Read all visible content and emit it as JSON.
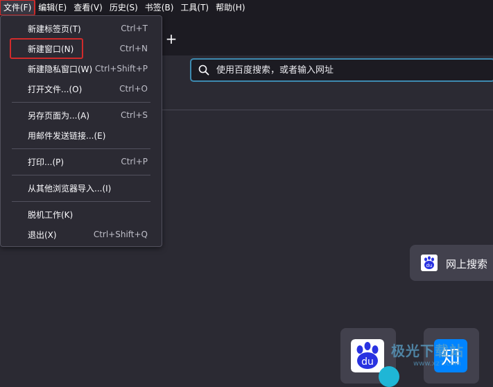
{
  "menubar": {
    "items": [
      "文件(F)",
      "编辑(E)",
      "查看(V)",
      "历史(S)",
      "书签(B)",
      "工具(T)",
      "帮助(H)"
    ]
  },
  "tabstrip": {
    "new_tab_label": "+"
  },
  "urlbar": {
    "placeholder": "使用百度搜索，或者输入网址"
  },
  "file_menu": {
    "items": [
      {
        "label": "新建标签页(T)",
        "shortcut": "Ctrl+T"
      },
      {
        "label": "新建窗口(N)",
        "shortcut": "Ctrl+N"
      },
      {
        "label": "新建隐私窗口(W)",
        "shortcut": "Ctrl+Shift+P"
      },
      {
        "label": "打开文件...(O)",
        "shortcut": "Ctrl+O"
      },
      {
        "label": "另存页面为...(A)",
        "shortcut": "Ctrl+S"
      },
      {
        "label": "用邮件发送链接...(E)",
        "shortcut": ""
      },
      {
        "label": "打印...(P)",
        "shortcut": "Ctrl+P"
      },
      {
        "label": "从其他浏览器导入...(I)",
        "shortcut": ""
      },
      {
        "label": "脱机工作(K)",
        "shortcut": ""
      },
      {
        "label": "退出(X)",
        "shortcut": "Ctrl+Shift+Q"
      }
    ]
  },
  "newtab_page": {
    "search_card_label": "网上搜索",
    "tiles": [
      {
        "icon": "baidu-paw-icon",
        "logo_text": "du"
      },
      {
        "icon": "zhihu-icon",
        "logo_text": "知"
      }
    ]
  },
  "watermark": {
    "text": "极光下载站",
    "sub": "www.xz7.com"
  },
  "colors": {
    "menubar_bg": "#1c1b22",
    "page_bg": "#2b2a33",
    "highlight_border": "#d12b2b",
    "urlbar_focus": "#3d8ab0",
    "baidu_blue": "#2932e1",
    "zhihu_blue": "#0084ff"
  }
}
